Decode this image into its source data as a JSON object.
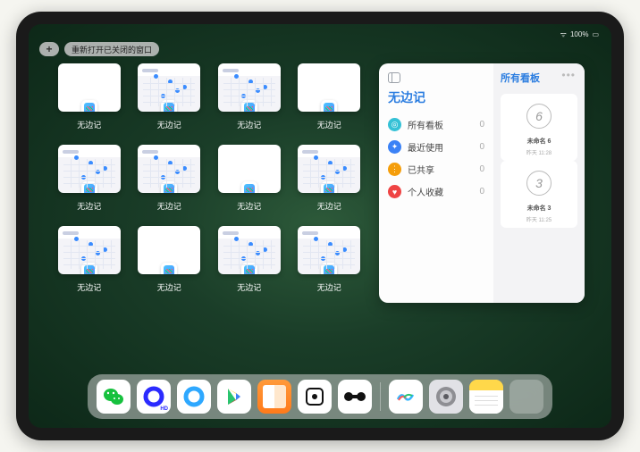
{
  "status": {
    "time": "",
    "wifi": "⋮",
    "battery": "100%"
  },
  "topbar": {
    "add_label": "+",
    "reopen_label": "重新打开已关闭的窗口"
  },
  "thumbnails": [
    {
      "label": "无边记",
      "variant": "blank"
    },
    {
      "label": "无边记",
      "variant": "calendar"
    },
    {
      "label": "无边记",
      "variant": "calendar"
    },
    {
      "label": "无边记",
      "variant": "blank"
    },
    {
      "label": "无边记",
      "variant": "calendar"
    },
    {
      "label": "无边记",
      "variant": "calendar"
    },
    {
      "label": "无边记",
      "variant": "blank"
    },
    {
      "label": "无边记",
      "variant": "calendar"
    },
    {
      "label": "无边记",
      "variant": "calendar"
    },
    {
      "label": "无边记",
      "variant": "blank"
    },
    {
      "label": "无边记",
      "variant": "calendar"
    },
    {
      "label": "无边记",
      "variant": "calendar"
    }
  ],
  "panel": {
    "title": "无边记",
    "right_title": "所有看板",
    "items": [
      {
        "icon_bg": "#35c1d6",
        "icon_glyph": "◎",
        "label": "所有看板",
        "count": "0"
      },
      {
        "icon_bg": "#3b82f6",
        "icon_glyph": "✦",
        "label": "最近使用",
        "count": "0"
      },
      {
        "icon_bg": "#f59e0b",
        "icon_glyph": "⋮",
        "label": "已共享",
        "count": "0"
      },
      {
        "icon_bg": "#ef4444",
        "icon_glyph": "♥",
        "label": "个人收藏",
        "count": "0"
      }
    ],
    "boards": [
      {
        "char": "6",
        "name": "未命名 6",
        "date": "昨天 11:28"
      },
      {
        "char": "3",
        "name": "未命名 3",
        "date": "昨天 11:25"
      }
    ]
  },
  "dock": {
    "apps": [
      {
        "name": "wechat",
        "bg": "#ffffff",
        "glyph_color": "#17c13e"
      },
      {
        "name": "quark-hd",
        "bg": "#ffffff",
        "glyph_color": "#2b2bff"
      },
      {
        "name": "quark",
        "bg": "#ffffff",
        "glyph_color": "#2ea8ff"
      },
      {
        "name": "play",
        "bg": "#ffffff",
        "glyph_color": ""
      },
      {
        "name": "books",
        "bg": "linear-gradient(#ff9a3a,#ff7a1a)",
        "glyph_color": "#fff"
      },
      {
        "name": "dice",
        "bg": "#ffffff",
        "glyph_color": "#111"
      },
      {
        "name": "barbell",
        "bg": "#ffffff",
        "glyph_color": "#111"
      }
    ],
    "recent": [
      {
        "name": "freeform",
        "bg": "#ffffff"
      },
      {
        "name": "settings",
        "bg": "#e1e1e6"
      },
      {
        "name": "notes",
        "bg": "linear-gradient(#ffd84a 30%, #fff 30%)"
      },
      {
        "name": "app-library",
        "bg": ""
      }
    ]
  }
}
